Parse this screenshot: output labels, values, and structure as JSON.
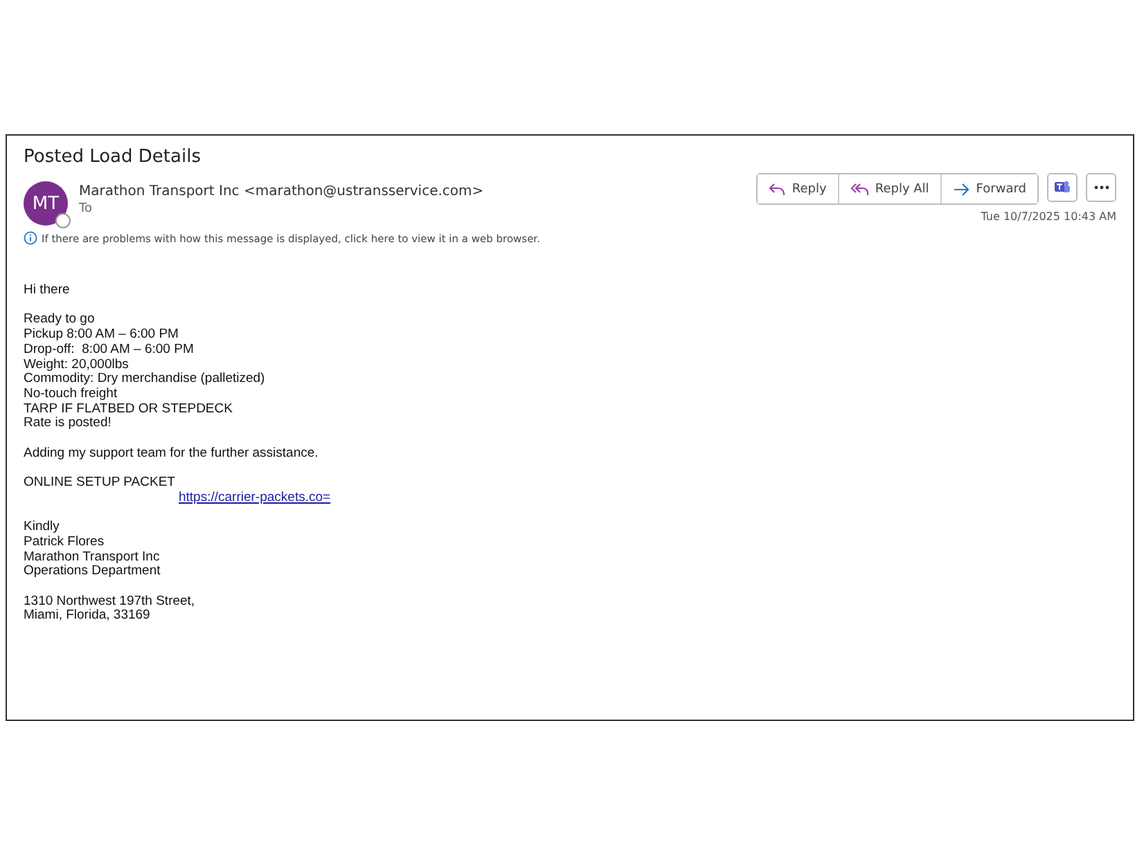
{
  "message": {
    "subject": "Posted Load Details",
    "sender": {
      "initials": "MT",
      "name": "Marathon Transport Inc <marathon@ustransservice.com>",
      "to_label": "To"
    },
    "info_bar": "If there are problems with how this message is displayed, click here to view it in a web browser.",
    "actions": [
      {
        "label": "Reply",
        "kind": "reply"
      },
      {
        "label": "Reply All",
        "kind": "reply_all"
      },
      {
        "label": "Forward",
        "kind": "forward"
      }
    ],
    "date": "Tue 10/7/2025 10:43 AM",
    "body": [
      [
        {
          "kind": "text",
          "text": "Hi there"
        }
      ],
      [
        {
          "kind": "text",
          "text": "Ready to go"
        },
        {
          "kind": "text",
          "text": "Pickup 8:00 AM – 6:00 PM"
        },
        {
          "kind": "text",
          "text": "Drop-off:  8:00 AM – 6:00 PM"
        },
        {
          "kind": "text",
          "text": "Weight: 20,000lbs"
        },
        {
          "kind": "text",
          "text": "Commodity: Dry merchandise (palletized)"
        },
        {
          "kind": "text",
          "text": "No-touch freight"
        },
        {
          "kind": "text",
          "text": "TARP IF FLATBED OR STEPDECK"
        },
        {
          "kind": "text",
          "text": "Rate is posted!"
        }
      ],
      [
        {
          "kind": "text",
          "text": "Adding my support team for the further assistance."
        }
      ],
      [
        {
          "kind": "text",
          "text": "ONLINE SETUP PACKET"
        },
        {
          "kind": "link",
          "text": "https://carrier-packets.co="
        }
      ],
      [
        {
          "kind": "text",
          "text": "Kindly"
        },
        {
          "kind": "text",
          "text": "Patrick Flores"
        },
        {
          "kind": "text",
          "text": "Marathon Transport Inc"
        },
        {
          "kind": "text",
          "text": "Operations Department"
        }
      ],
      [
        {
          "kind": "text",
          "text": "1310 Northwest 197th Street,"
        },
        {
          "kind": "text",
          "text": "Miami, Florida, 33169"
        }
      ]
    ]
  }
}
